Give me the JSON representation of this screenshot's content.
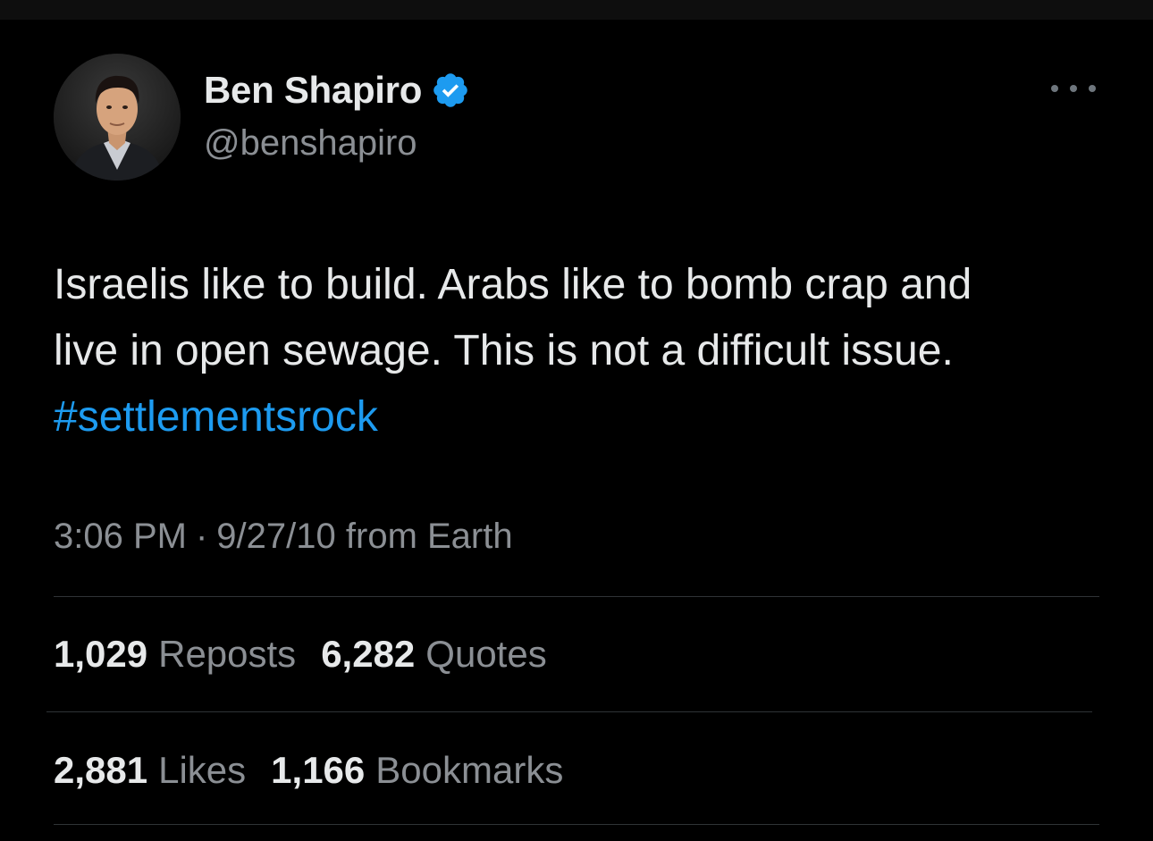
{
  "author": {
    "display_name": "Ben Shapiro",
    "handle": "@benshapiro",
    "verified": true,
    "verified_icon": "verified-badge-icon",
    "avatar_icon": "profile-photo"
  },
  "menu": {
    "more_icon": "more-options-icon"
  },
  "tweet": {
    "line1": "Israelis like to build. Arabs like to bomb crap and",
    "line2": "live in open sewage. This is not a difficult issue.",
    "hashtag": "#settlementsrock"
  },
  "meta": {
    "time": "3:06 PM",
    "separator": "·",
    "date": "9/27/10",
    "source": "from Earth"
  },
  "stats": {
    "reposts_count": "1,029",
    "reposts_label": "Reposts",
    "quotes_count": "6,282",
    "quotes_label": "Quotes",
    "likes_count": "2,881",
    "likes_label": "Likes",
    "bookmarks_count": "1,166",
    "bookmarks_label": "Bookmarks"
  },
  "colors": {
    "background": "#000000",
    "text": "#e7e9ea",
    "secondary_text": "#8b8f94",
    "link": "#1d9bf0",
    "verified": "#1d9bf0",
    "divider": "#2f3336"
  }
}
